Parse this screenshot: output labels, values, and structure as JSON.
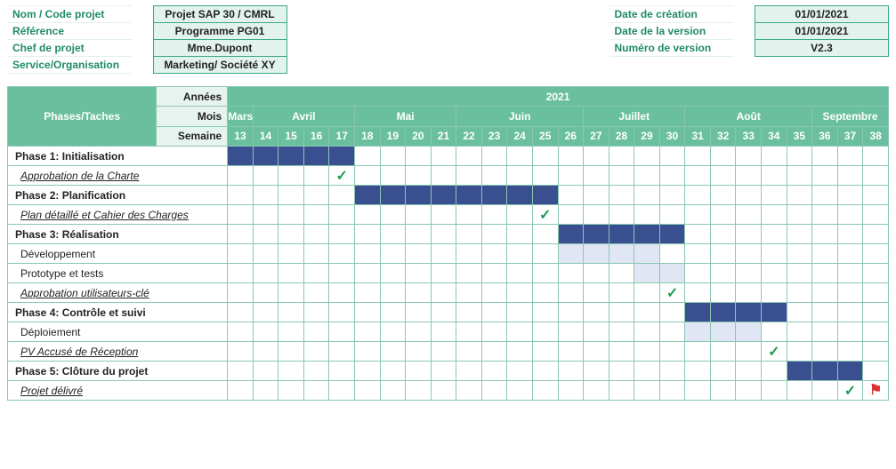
{
  "info": {
    "left": [
      {
        "label": "Nom / Code projet",
        "value": "Projet SAP 30 / CMRL"
      },
      {
        "label": "Référence",
        "value": "Programme PG01"
      },
      {
        "label": "Chef de projet",
        "value": "Mme.Dupont"
      },
      {
        "label": "Service/Organisation",
        "value": "Marketing/ Société XY"
      }
    ],
    "right": [
      {
        "label": "Date de création",
        "value": "01/01/2021"
      },
      {
        "label": "Date de la version",
        "value": "01/01/2021"
      },
      {
        "label": "Numéro de version",
        "value": "V2.3"
      }
    ]
  },
  "axis": {
    "years_label": "Années",
    "year": "2021",
    "months_label": "Mois",
    "months": [
      {
        "name": "Mars",
        "span": 1
      },
      {
        "name": "Avril",
        "span": 4
      },
      {
        "name": "Mai",
        "span": 4
      },
      {
        "name": "Juin",
        "span": 5
      },
      {
        "name": "Juillet",
        "span": 4
      },
      {
        "name": "Août",
        "span": 5
      },
      {
        "name": "Septembre",
        "span": 3
      }
    ],
    "weeks_label": "Semaine",
    "weeks": [
      13,
      14,
      15,
      16,
      17,
      18,
      19,
      20,
      21,
      22,
      23,
      24,
      25,
      26,
      27,
      28,
      29,
      30,
      31,
      32,
      33,
      34,
      35,
      36,
      37,
      38
    ]
  },
  "tasks_header": "Phases/Taches",
  "rows": [
    {
      "label": "Phase 1: Initialisation",
      "level": 0,
      "milestone": false,
      "fill": "d",
      "start": 13,
      "end": 17
    },
    {
      "label": "Approbation de la Charte",
      "level": 1,
      "milestone": true,
      "flag": false,
      "at": 17
    },
    {
      "label": "Phase 2: Planification",
      "level": 0,
      "milestone": false,
      "fill": "d",
      "start": 18,
      "end": 25
    },
    {
      "label": "Plan détaillé et Cahier des Charges",
      "level": 1,
      "milestone": true,
      "flag": false,
      "at": 25
    },
    {
      "label": "Phase 3: Réalisation",
      "level": 0,
      "milestone": false,
      "fill": "d",
      "start": 26,
      "end": 30
    },
    {
      "label": "Développement",
      "level": 1,
      "milestone": false,
      "fill": "l",
      "start": 26,
      "end": 29
    },
    {
      "label": "Prototype et tests",
      "level": 1,
      "milestone": false,
      "fill": "l",
      "start": 29,
      "end": 30
    },
    {
      "label": "Approbation utilisateurs-clé",
      "level": 1,
      "milestone": true,
      "flag": false,
      "at": 30
    },
    {
      "label": "Phase 4: Contrôle et suivi",
      "level": 0,
      "milestone": false,
      "fill": "d",
      "start": 31,
      "end": 34
    },
    {
      "label": "Déploiement",
      "level": 1,
      "milestone": false,
      "fill": "l",
      "start": 31,
      "end": 33
    },
    {
      "label": "PV Accusé de Réception",
      "level": 1,
      "milestone": true,
      "flag": false,
      "at": 34
    },
    {
      "label": "Phase 5: Clôture du projet",
      "level": 0,
      "milestone": false,
      "fill": "d",
      "start": 35,
      "end": 37
    },
    {
      "label": "Projet délivré",
      "level": 1,
      "milestone": true,
      "flag": true,
      "at": 37
    }
  ],
  "chart_data": {
    "type": "gantt",
    "title": "Phases/Taches",
    "x_unit": "Semaine",
    "x_range": [
      13,
      38
    ],
    "year": 2021,
    "months": [
      "Mars",
      "Avril",
      "Mai",
      "Juin",
      "Juillet",
      "Août",
      "Septembre"
    ],
    "series": [
      {
        "name": "Phase 1: Initialisation",
        "type": "phase",
        "start_week": 13,
        "end_week": 17
      },
      {
        "name": "Approbation de la Charte",
        "type": "milestone",
        "week": 17,
        "parent": "Phase 1: Initialisation"
      },
      {
        "name": "Phase 2: Planification",
        "type": "phase",
        "start_week": 18,
        "end_week": 25
      },
      {
        "name": "Plan détaillé et Cahier des Charges",
        "type": "milestone",
        "week": 25,
        "parent": "Phase 2: Planification"
      },
      {
        "name": "Phase 3: Réalisation",
        "type": "phase",
        "start_week": 26,
        "end_week": 30
      },
      {
        "name": "Développement",
        "type": "task",
        "start_week": 26,
        "end_week": 29,
        "parent": "Phase 3: Réalisation"
      },
      {
        "name": "Prototype et tests",
        "type": "task",
        "start_week": 29,
        "end_week": 30,
        "parent": "Phase 3: Réalisation"
      },
      {
        "name": "Approbation utilisateurs-clé",
        "type": "milestone",
        "week": 30,
        "parent": "Phase 3: Réalisation"
      },
      {
        "name": "Phase 4: Contrôle et suivi",
        "type": "phase",
        "start_week": 31,
        "end_week": 34
      },
      {
        "name": "Déploiement",
        "type": "task",
        "start_week": 31,
        "end_week": 33,
        "parent": "Phase 4: Contrôle et suivi"
      },
      {
        "name": "PV Accusé de Réception",
        "type": "milestone",
        "week": 34,
        "parent": "Phase 4: Contrôle et suivi"
      },
      {
        "name": "Phase 5: Clôture du projet",
        "type": "phase",
        "start_week": 35,
        "end_week": 37
      },
      {
        "name": "Projet délivré",
        "type": "milestone",
        "week": 37,
        "end_flag_week": 38,
        "parent": "Phase 5: Clôture du projet"
      }
    ]
  }
}
